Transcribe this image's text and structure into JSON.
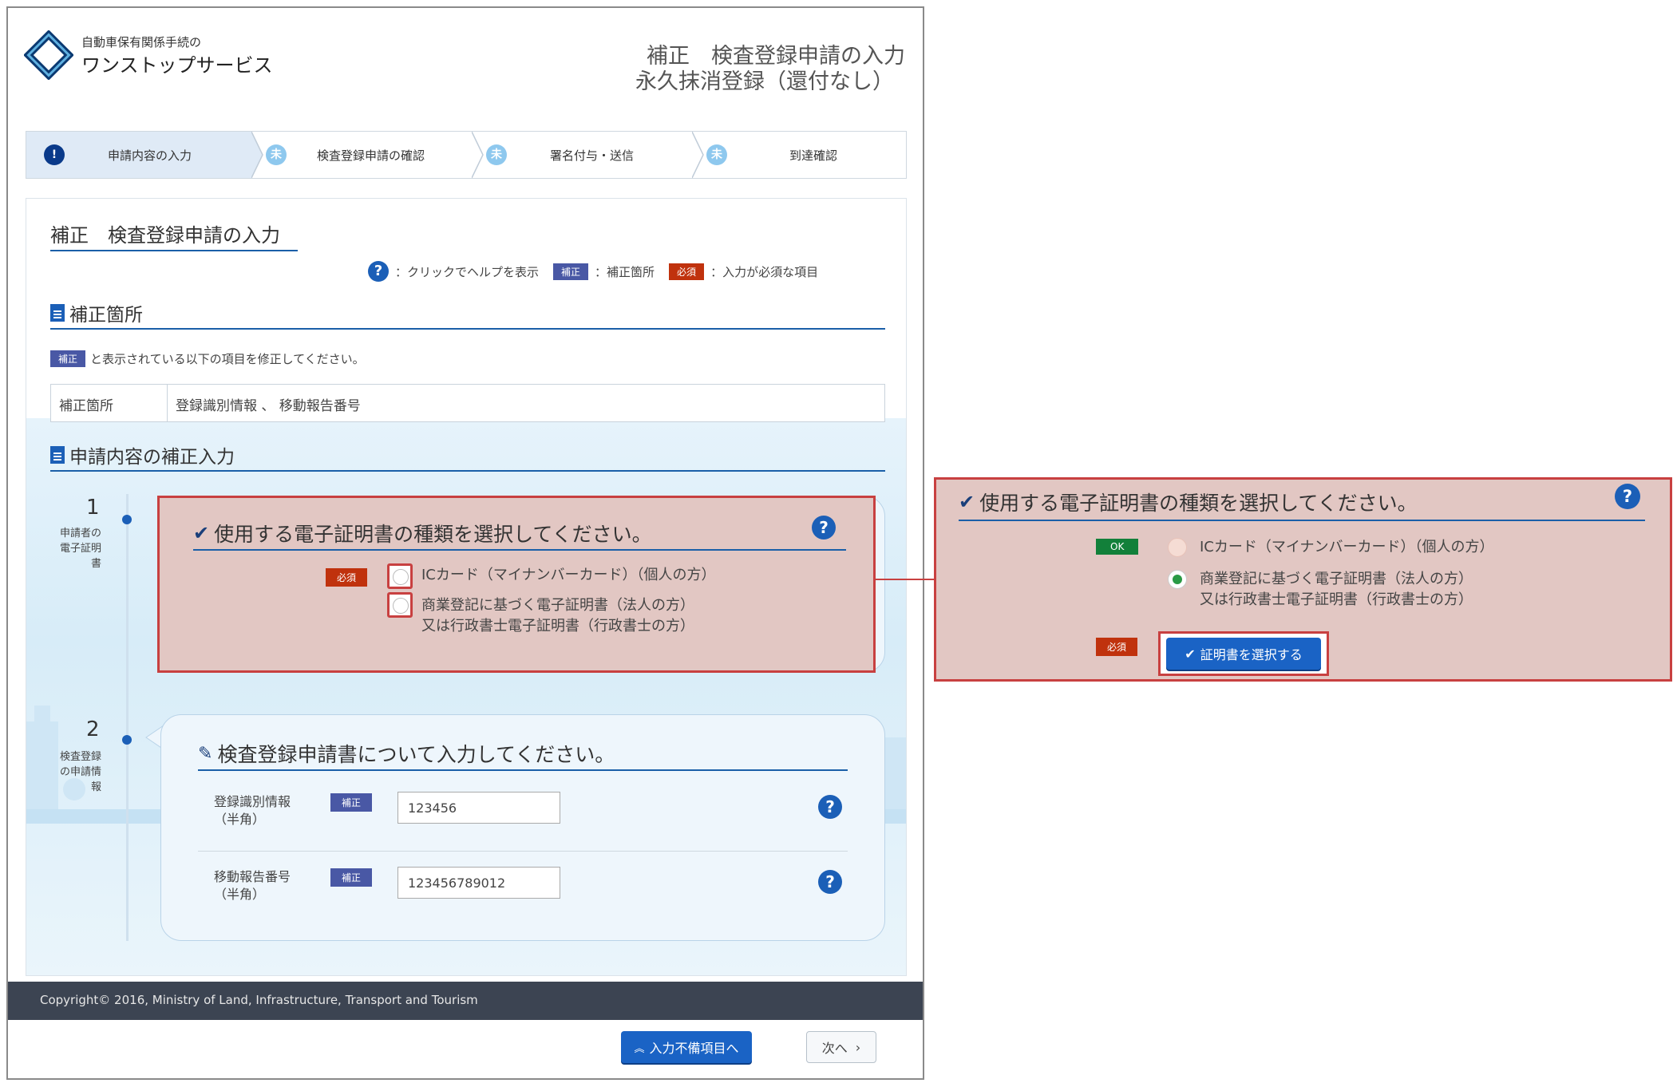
{
  "header": {
    "logo_sub": "自動車保有関係手続の",
    "logo_main": "ワンストップサービス",
    "title_line1": "補正　検査登録申請の入力",
    "title_line2": "永久抹消登録（還付なし）"
  },
  "steps": [
    {
      "icon": "!",
      "label": "申請内容の入力"
    },
    {
      "icon": "未",
      "label": "検査登録申請の確認"
    },
    {
      "icon": "未",
      "label": "署名付与・送信"
    },
    {
      "icon": "未",
      "label": "到達確認"
    }
  ],
  "panel": {
    "title": "補正　検査登録申請の入力",
    "legend": {
      "help_text": "：クリックでヘルプを表示",
      "fix_tag": "補正",
      "fix_text": "：補正箇所",
      "req_tag": "必須",
      "req_text": "：入力が必須な項目"
    },
    "fix_section": {
      "heading": "補正箇所",
      "note_tag": "補正",
      "note": "と表示されている以下の項目を修正してください。",
      "table_header": "補正箇所",
      "table_value": "登録識別情報 、 移動報告番号"
    },
    "input_section": {
      "heading": "申請内容の補正入力"
    },
    "step1": {
      "number": "1",
      "sub_lines": [
        "申請者の",
        "電子証明",
        "書"
      ],
      "heading": "使用する電子証明書の種類を選択してください。",
      "req_tag": "必須",
      "option1": "ICカード（マイナンバーカード）（個人の方）",
      "option2_line1": "商業登記に基づく電子証明書（法人の方）",
      "option2_line2": "又は行政書士電子証明書（行政書士の方）"
    },
    "step2": {
      "number": "2",
      "sub_lines": [
        "検査登録",
        "の申請情",
        "報"
      ],
      "heading": "検査登録申請書について入力してください。",
      "field1_label_line1": "登録識別情報",
      "field1_label_line2": "（半角）",
      "field1_tag": "補正",
      "field1_value": "123456",
      "field2_label_line1": "移動報告番号",
      "field2_label_line2": "（半角）",
      "field2_tag": "補正",
      "field2_value": "123456789012"
    }
  },
  "footer": {
    "copyright": "Copyright© 2016, Ministry of Land, Infrastructure, Transport and Tourism"
  },
  "nav": {
    "back_label": "入力不備項目へ",
    "next_label": "次へ"
  },
  "zoom": {
    "heading": "使用する電子証明書の種類を選択してください。",
    "ok_tag": "OK",
    "option1": "ICカード（マイナンバーカード）（個人の方）",
    "option2_line1": "商業登記に基づく電子証明書（法人の方）",
    "option2_line2": "又は行政書士電子証明書（行政書士の方）",
    "req_tag": "必須",
    "select_button": "証明書を選択する",
    "selected_option": 2
  },
  "colors": {
    "accent": "#1a63c5",
    "highlight_border": "#c84040",
    "fix_tag": "#4958a5",
    "req_tag": "#c0320d",
    "ok_tag": "#12803a"
  }
}
